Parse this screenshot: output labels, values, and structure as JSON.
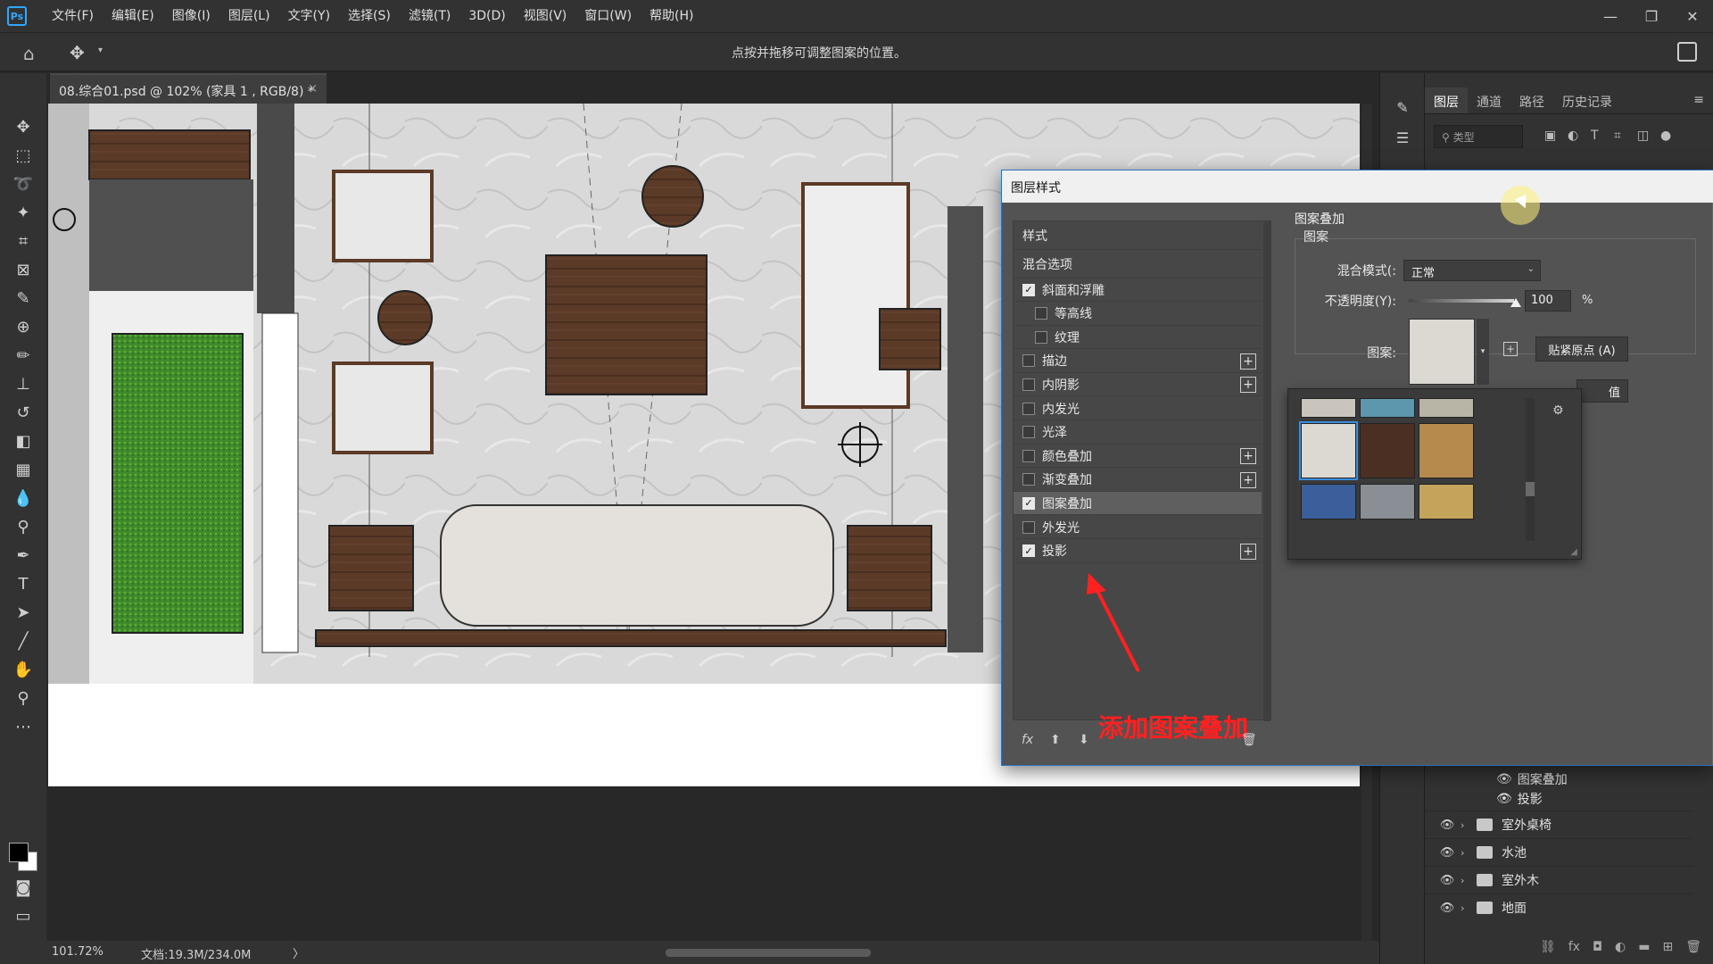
{
  "menubar": {
    "logo": "Ps",
    "items": [
      "文件(F)",
      "编辑(E)",
      "图像(I)",
      "图层(L)",
      "文字(Y)",
      "选择(S)",
      "滤镜(T)",
      "3D(D)",
      "视图(V)",
      "窗口(W)",
      "帮助(H)"
    ],
    "controls": [
      "—",
      "❐",
      "✕"
    ]
  },
  "options": {
    "hint": "点按并拖移可调整图案的位置。"
  },
  "document": {
    "tab_title": "08.综合01.psd @ 102% (家具 1 , RGB/8) *",
    "close": "×"
  },
  "status": {
    "zoom": "101.72%",
    "doc_size": "文档:19.3M/234.0M",
    "arrow": "〉"
  },
  "layers_panel": {
    "tabs": [
      "图层",
      "通道",
      "路径",
      "历史记录"
    ],
    "filter_placeholder": "类型",
    "effects": [
      "图案叠加",
      "投影"
    ],
    "groups": [
      "室外桌椅",
      "水池",
      "室外木",
      "地面"
    ]
  },
  "dialog": {
    "title": "图层样式",
    "styles_header": "样式",
    "blend_options": "混合选项",
    "styles": [
      {
        "label": "斜面和浮雕",
        "checked": true,
        "sub": false,
        "plus": false
      },
      {
        "label": "等高线",
        "checked": false,
        "sub": true,
        "plus": false
      },
      {
        "label": "纹理",
        "checked": false,
        "sub": true,
        "plus": false
      },
      {
        "label": "描边",
        "checked": false,
        "sub": false,
        "plus": true
      },
      {
        "label": "内阴影",
        "checked": false,
        "sub": false,
        "plus": true
      },
      {
        "label": "内发光",
        "checked": false,
        "sub": false,
        "plus": false
      },
      {
        "label": "光泽",
        "checked": false,
        "sub": false,
        "plus": false
      },
      {
        "label": "颜色叠加",
        "checked": false,
        "sub": false,
        "plus": true
      },
      {
        "label": "渐变叠加",
        "checked": false,
        "sub": false,
        "plus": true
      },
      {
        "label": "图案叠加",
        "checked": true,
        "sub": false,
        "plus": false,
        "selected": true
      },
      {
        "label": "外发光",
        "checked": false,
        "sub": false,
        "plus": false
      },
      {
        "label": "投影",
        "checked": true,
        "sub": false,
        "plus": true
      }
    ],
    "annotation": "添加图案叠加",
    "section_title": "图案叠加",
    "group_label": "图案",
    "blend_mode_label": "混合模式(:",
    "blend_mode_value": "正常",
    "opacity_label": "不透明度(Y):",
    "opacity_value": "100",
    "opacity_unit": "%",
    "pattern_label": "图案:",
    "snap_origin": "贴紧原点 (A)",
    "partial_button": "值",
    "pattern_colors": [
      "#c9c5bd",
      "#5c97ad",
      "#b8b4a6",
      "#dcd9d3",
      "#4a2f22",
      "#b58a4c",
      "#3a5f9a",
      "#8a8f96",
      "#c4a35a"
    ]
  }
}
